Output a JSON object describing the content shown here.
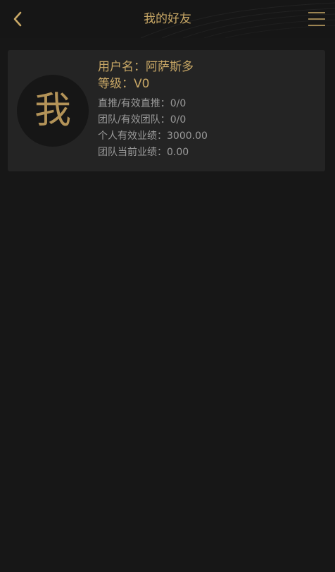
{
  "header": {
    "title": "我的好友",
    "back_icon": "chevron-left-icon",
    "menu_icon": "hamburger-menu-icon",
    "accent_color": "#c9a866"
  },
  "user_card": {
    "avatar_char": "我",
    "username_label": "用户名：",
    "username": "阿萨斯多",
    "level_label": "等级：",
    "level": "V0",
    "stats": [
      {
        "label": "直推/有效直推：",
        "value": "0/0"
      },
      {
        "label": "团队/有效团队：",
        "value": "0/0"
      },
      {
        "label": "个人有效业绩：",
        "value": "3000.00"
      },
      {
        "label": "团队当前业绩：",
        "value": "0.00"
      }
    ]
  }
}
